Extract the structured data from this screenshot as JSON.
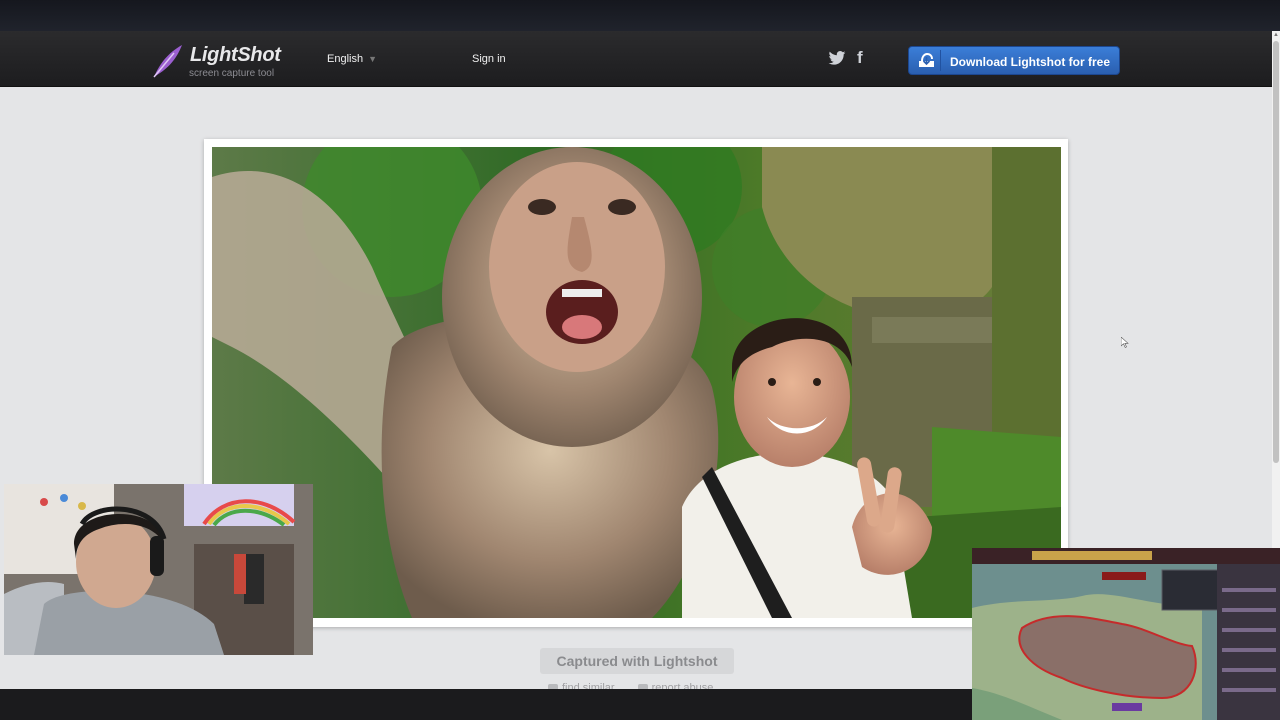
{
  "header": {
    "logo_name": "LightShot",
    "logo_tagline": "screen capture tool",
    "language": "English",
    "signin": "Sign in",
    "social_icons": [
      "twitter-icon",
      "facebook-icon"
    ],
    "facebook_glyph": "f",
    "download_label": "Download Lightshot for free",
    "accent_color": "#2f6bc4"
  },
  "main": {
    "captured_label": "Captured with Lightshot",
    "footer_links": [
      "find similar",
      "report abuse"
    ]
  },
  "overlays": {
    "webcam": "webcam-overlay",
    "game": "game-map-overlay"
  }
}
